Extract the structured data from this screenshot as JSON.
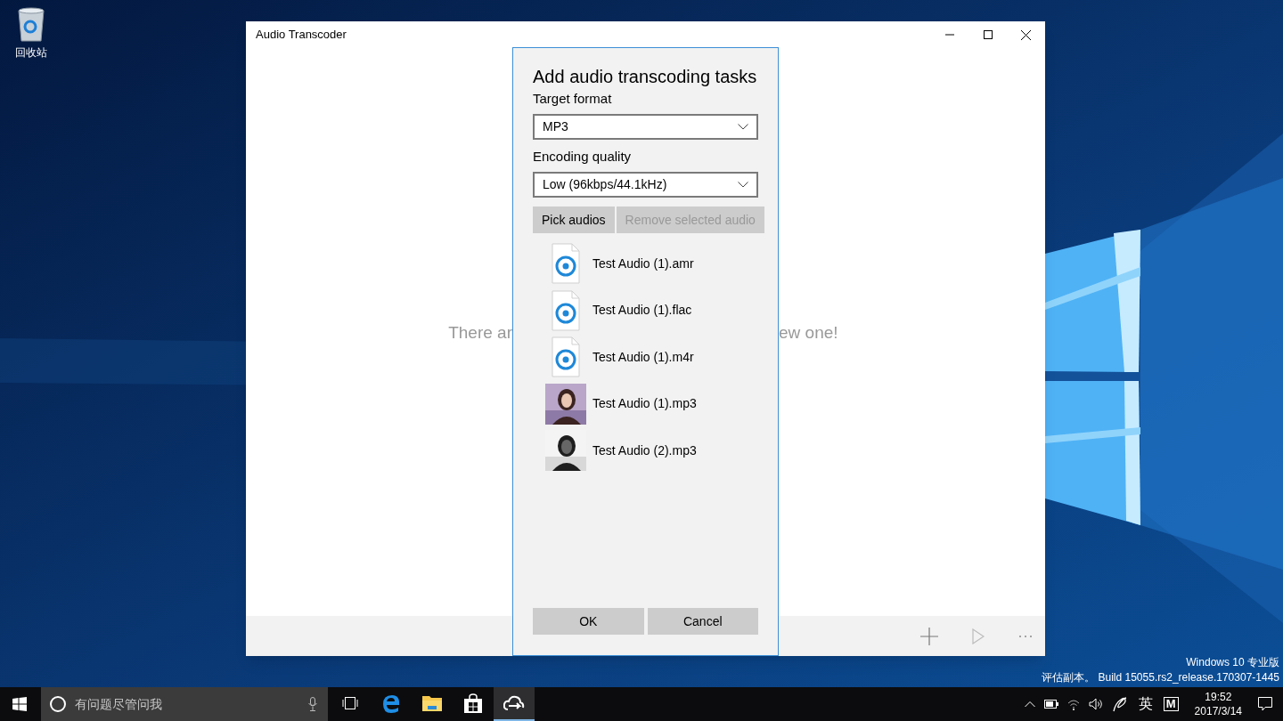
{
  "desktop": {
    "icons": [
      {
        "label": "回收站"
      }
    ],
    "watermark": [
      "Windows 10 专业版",
      "评估副本。 Build 15055.rs2_release.170307-1445"
    ]
  },
  "window": {
    "title": "Audio Transcoder",
    "empty_message_parts": [
      "There ar",
      "ew one!"
    ]
  },
  "dialog": {
    "title": "Add audio transcoding tasks",
    "fields": [
      {
        "label": "Target format",
        "value": "MP3"
      },
      {
        "label": "Encoding quality",
        "value": "Low (96kbps/44.1kHz)"
      }
    ],
    "actions": [
      {
        "label": "Pick audios",
        "disabled": false
      },
      {
        "label": "Remove selected audio",
        "disabled": true
      }
    ],
    "files": [
      {
        "name": "Test Audio (1).amr",
        "kind": "file-icon"
      },
      {
        "name": "Test Audio (1).flac",
        "kind": "file-icon"
      },
      {
        "name": "Test Audio (1).m4r",
        "kind": "file-icon"
      },
      {
        "name": "Test Audio (1).mp3",
        "kind": "picture"
      },
      {
        "name": "Test Audio (2).mp3",
        "kind": "picture"
      }
    ],
    "buttons": [
      "OK",
      "Cancel"
    ]
  },
  "taskbar": {
    "search_placeholder": "有问题尽管问我",
    "apps": [
      {
        "kind": "task-view",
        "active": false
      },
      {
        "kind": "browser",
        "active": false
      },
      {
        "kind": "folder",
        "active": false
      },
      {
        "kind": "store",
        "active": false
      },
      {
        "kind": "app",
        "active": true
      }
    ],
    "ime": "英",
    "ime_mode": "M",
    "time": "19:52",
    "date": "2017/3/14"
  }
}
